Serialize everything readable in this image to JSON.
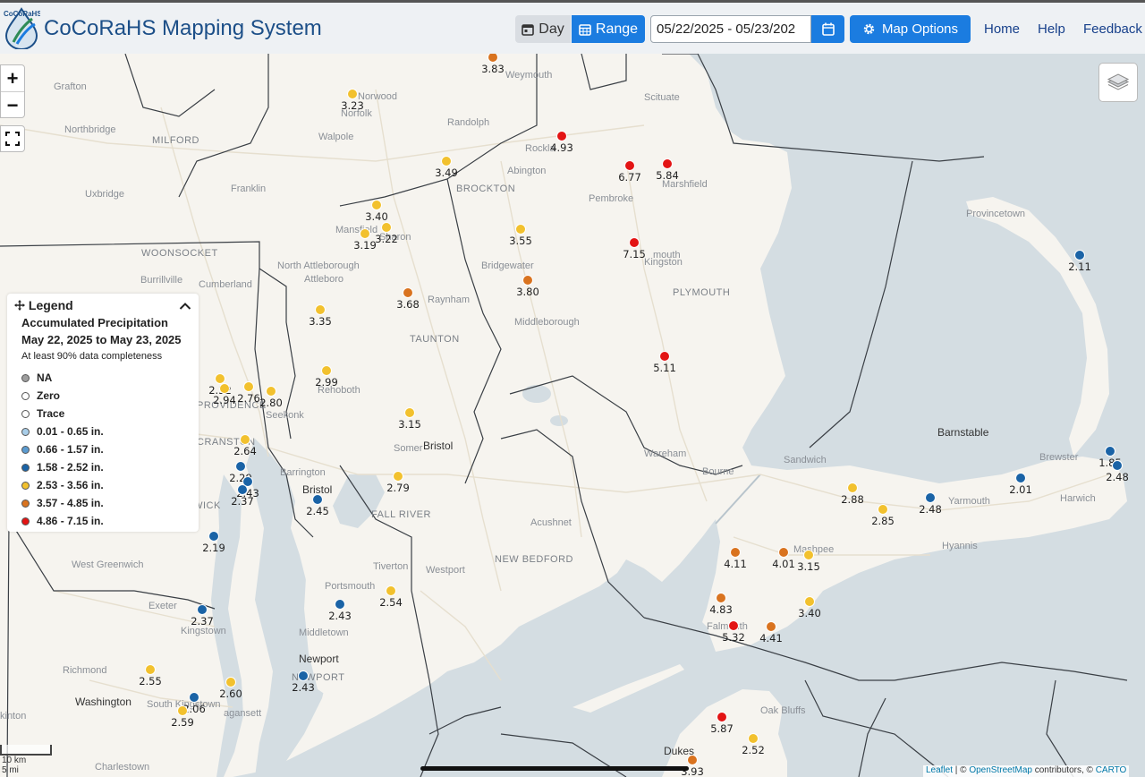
{
  "header": {
    "logo_text": "CoCoRaHS",
    "title": "CoCoRaHS Mapping System",
    "day_label": "Day",
    "range_label": "Range",
    "date_range_value": "05/22/2025 - 05/23/202",
    "map_options_label": "Map Options",
    "nav": [
      "Home",
      "Help",
      "Feedback"
    ]
  },
  "colors": {
    "header_bg": "#eef1f4",
    "title_blue": "#1c4f88",
    "button_blue": "#1b7ce0",
    "water": "#d4dde2",
    "land": "#f6f4ef",
    "na": "#9e9e9e",
    "zero": "#ffffff",
    "trace": "#ffffff",
    "c1": "#a8cde8",
    "c2": "#5b9bd0",
    "c3": "#1a63a6",
    "c4": "#f2c12e",
    "c5": "#d9731f",
    "c6": "#e31414"
  },
  "legend": {
    "header": "Legend",
    "title": "Accumulated Precipitation",
    "range": "May 22, 2025 to May 23, 2025",
    "note": "At least 90% data completeness",
    "items": [
      {
        "label": "NA",
        "color": "#9e9e9e"
      },
      {
        "label": "Zero",
        "color": "#ffffff"
      },
      {
        "label": "Trace",
        "color": "#ffffff"
      },
      {
        "label": "0.01 - 0.65 in.",
        "color": "#a8cde8"
      },
      {
        "label": "0.66 - 1.57 in.",
        "color": "#5b9bd0"
      },
      {
        "label": "1.58 - 2.52 in.",
        "color": "#1a63a6"
      },
      {
        "label": "2.53 - 3.56 in.",
        "color": "#f2c12e"
      },
      {
        "label": "3.57 - 4.85 in.",
        "color": "#d9731f"
      },
      {
        "label": "4.86 - 7.15 in.",
        "color": "#e31414"
      }
    ]
  },
  "places": {
    "grafton": "Grafton",
    "northbridge": "Northbridge",
    "milford": "MILFORD",
    "uxbridge": "Uxbridge",
    "franklin": "Franklin",
    "norwood": "Norwood",
    "norfolk": "Norfolk",
    "walpole": "Walpole",
    "randolph": "Randolph",
    "weymouth": "Weymouth",
    "scituate": "Scituate",
    "rockland": "Rockla",
    "abington": "Abington",
    "brockton": "BROCKTON",
    "marshfield": "Marshfield",
    "pembroke": "Pembroke",
    "mansfield": "Mansfield",
    "sharon": "Sharon",
    "woonsocket": "WOONSOCKET",
    "burrillville": "Burrillville",
    "cumberland": "Cumberland",
    "north_attleborough": "North Attleborough",
    "attleboro": "Attleboro",
    "raynham": "Raynham",
    "bridgewater": "Bridgewater",
    "plymouth_town": "mouth",
    "kingston": "Kingston",
    "plymouth": "PLYMOUTH",
    "provincetown": "Provincetown",
    "taunton": "TAUNTON",
    "middleborough": "Middleborough",
    "rehoboth": "Rehoboth",
    "seekonk": "Seekonk",
    "providence": "PROVIDENCE",
    "cranston": "CRANSTON",
    "somerset": "Somer",
    "bristol_ma": "Bristol",
    "barrington": "Barrington",
    "bristol_ri": "Bristol",
    "fall_river": "FALL RIVER",
    "wareham": "Wareham",
    "sandwich": "Sandwich",
    "bourne": "Bourne",
    "barnstable": "Barnstable",
    "brewster": "Brewster",
    "yarmouth": "Yarmouth",
    "harwich": "Harwich",
    "hyannis": "Hyannis",
    "mashpee": "Mashpee",
    "falmouth": "Falmouth",
    "acushnet": "Acushnet",
    "new_bedford": "NEW BEDFORD",
    "westport": "Westport",
    "tiverton": "Tiverton",
    "portsmouth": "Portsmouth",
    "middletown": "Middletown",
    "newport": "Newport",
    "newport_caps": "NEWPORT",
    "warwick": "ARWICK",
    "west_greenwich": "West Greenwich",
    "exeter": "Exeter",
    "kingstown": "Kingstown",
    "richmond": "Richmond",
    "washington": "Washington",
    "south_kingstown": "South Kingstown",
    "hopkinton": "kinton",
    "narragansett": "agansett",
    "charlestown": "Charlestown",
    "oak_bluffs": "Oak Bluffs",
    "dukes": "Dukes"
  },
  "stations": [
    {
      "value": "3.83",
      "color": "#d9731f"
    },
    {
      "value": "3.23",
      "color": "#f2c12e"
    },
    {
      "value": "4.93",
      "color": "#e31414"
    },
    {
      "value": "3.49",
      "color": "#f2c12e"
    },
    {
      "value": "6.77",
      "color": "#e31414"
    },
    {
      "value": "5.84",
      "color": "#e31414"
    },
    {
      "value": "3.40",
      "color": "#f2c12e"
    },
    {
      "value": "3.22",
      "color": "#f2c12e"
    },
    {
      "value": "3.19",
      "color": "#f2c12e"
    },
    {
      "value": "3.55",
      "color": "#f2c12e"
    },
    {
      "value": "7.15",
      "color": "#e31414"
    },
    {
      "value": "2.11",
      "color": "#1a63a6"
    },
    {
      "value": "3.80",
      "color": "#d9731f"
    },
    {
      "value": "3.68",
      "color": "#d9731f"
    },
    {
      "value": "3.35",
      "color": "#f2c12e"
    },
    {
      "value": "5.11",
      "color": "#e31414"
    },
    {
      "value": "2.99",
      "color": "#f2c12e"
    },
    {
      "value": "2.32",
      "color": "#f2c12e"
    },
    {
      "value": "2.94",
      "color": "#f2c12e"
    },
    {
      "value": "2.76",
      "color": "#f2c12e"
    },
    {
      "value": "2.80",
      "color": "#f2c12e"
    },
    {
      "value": "3.15",
      "color": "#f2c12e"
    },
    {
      "value": "2.64",
      "color": "#f2c12e"
    },
    {
      "value": "2.79",
      "color": "#f2c12e"
    },
    {
      "value": "2.29",
      "color": "#1a63a6"
    },
    {
      "value": "2.43",
      "color": "#1a63a6"
    },
    {
      "value": "2.37",
      "color": "#1a63a6"
    },
    {
      "value": "2.45",
      "color": "#1a63a6"
    },
    {
      "value": "2.19",
      "color": "#1a63a6"
    },
    {
      "value": "1.85",
      "color": "#1a63a6"
    },
    {
      "value": "2.48",
      "color": "#1a63a6"
    },
    {
      "value": "2.01",
      "color": "#1a63a6"
    },
    {
      "value": "2.88",
      "color": "#f2c12e"
    },
    {
      "value": "2.48",
      "color": "#1a63a6"
    },
    {
      "value": "2.85",
      "color": "#f2c12e"
    },
    {
      "value": "4.11",
      "color": "#d9731f"
    },
    {
      "value": "4.01",
      "color": "#d9731f"
    },
    {
      "value": "3.15",
      "color": "#f2c12e"
    },
    {
      "value": "3.40",
      "color": "#f2c12e"
    },
    {
      "value": "4.83",
      "color": "#d9731f"
    },
    {
      "value": "5.32",
      "color": "#e31414"
    },
    {
      "value": "4.41",
      "color": "#d9731f"
    },
    {
      "value": "2.54",
      "color": "#f2c12e"
    },
    {
      "value": "2.43",
      "color": "#1a63a6"
    },
    {
      "value": "2.37",
      "color": "#1a63a6"
    },
    {
      "value": "2.43",
      "color": "#1a63a6"
    },
    {
      "value": "2.55",
      "color": "#f2c12e"
    },
    {
      "value": "2.60",
      "color": "#f2c12e"
    },
    {
      "value": "2.06",
      "color": "#1a63a6"
    },
    {
      "value": "2.59",
      "color": "#f2c12e"
    },
    {
      "value": "5.87",
      "color": "#e31414"
    },
    {
      "value": "2.52",
      "color": "#f2c12e"
    },
    {
      "value": "3.93",
      "color": "#d9731f"
    }
  ],
  "scale": {
    "km": "10 km",
    "mi": "5 mi"
  },
  "attribution": {
    "leaflet": "Leaflet",
    "sep": " | © ",
    "osm": "OpenStreetMap",
    "mid": " contributors, © ",
    "carto": "CARTO"
  }
}
